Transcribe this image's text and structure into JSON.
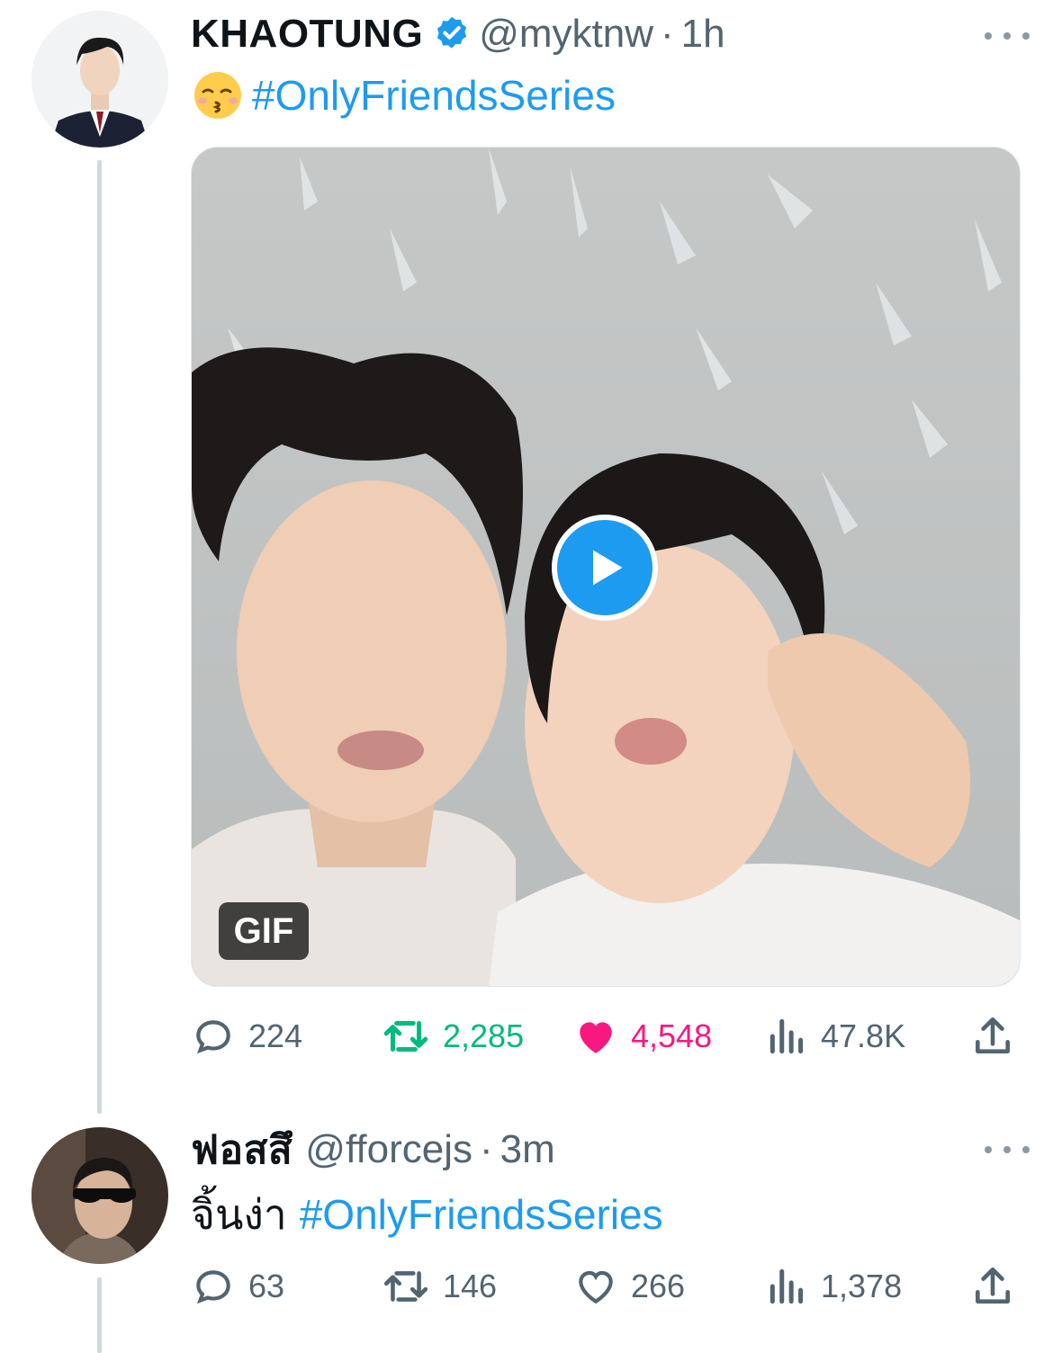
{
  "tweets": [
    {
      "author": {
        "display_name": "KHAOTUNG",
        "handle": "@myktnw",
        "verified": true
      },
      "time": "1h",
      "separator": "·",
      "emoji": "kissing-face-with-closed-eyes",
      "hashtag": "#OnlyFriendsSeries",
      "media": {
        "type": "gif",
        "badge": "GIF",
        "play_icon": "play-icon"
      },
      "stats": {
        "replies": "224",
        "retweets": "2,285",
        "likes": "4,548",
        "views": "47.8K"
      },
      "retweeted": true,
      "liked": true
    },
    {
      "author": {
        "display_name": "ฟอสสึ",
        "handle": "@fforcejs",
        "verified": false
      },
      "time": "3m",
      "separator": "·",
      "text": "จิ้นง่า",
      "hashtag": "#OnlyFriendsSeries",
      "stats": {
        "replies": "63",
        "retweets": "146",
        "likes": "266",
        "views": "1,378"
      },
      "retweeted": false,
      "liked": false
    }
  ],
  "colors": {
    "accent": "#1d9bf0",
    "retweet_active": "#00ba7c",
    "like_active": "#f91880",
    "muted": "#536471",
    "thread_line": "#cfd9de"
  }
}
